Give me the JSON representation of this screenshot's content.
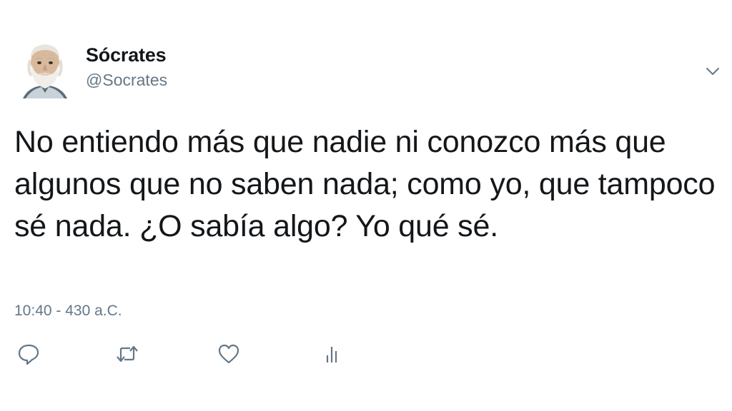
{
  "tweet": {
    "author": {
      "name": "Sócrates",
      "handle": "@Socrates",
      "avatar_icon": "socrates-bust-avatar"
    },
    "text": "No entiendo más que nadie ni conozco más que algunos que no saben nada; como yo, que tampoco sé nada. ¿O sabía algo? Yo qué sé.",
    "timestamp": "10:40 - 430 a.C."
  },
  "icons": {
    "menu": "chevron-down-icon",
    "reply": "reply-icon",
    "retweet": "retweet-icon",
    "like": "heart-icon",
    "analytics": "analytics-icon"
  },
  "colors": {
    "text": "#14171a",
    "secondary": "#657786",
    "icon": "#657786",
    "background": "#ffffff"
  }
}
